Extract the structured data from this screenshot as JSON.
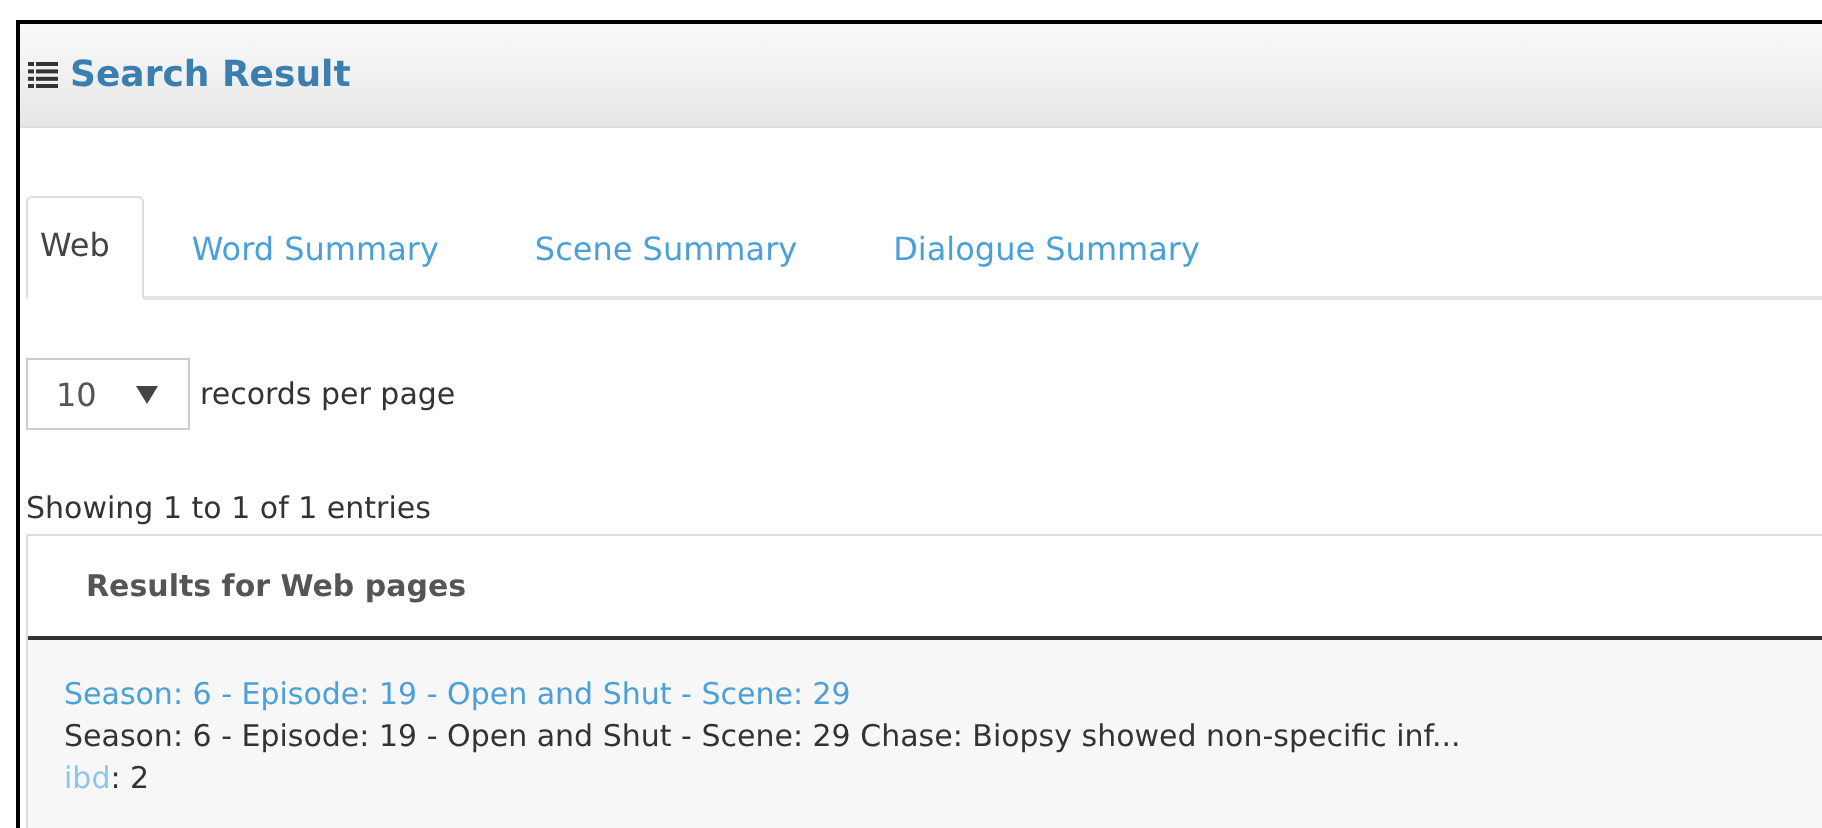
{
  "panel": {
    "title": "Search Result"
  },
  "tabs": [
    {
      "label": "Web",
      "selected": true
    },
    {
      "label": "Word Summary",
      "selected": false
    },
    {
      "label": "Scene Summary",
      "selected": false
    },
    {
      "label": "Dialogue Summary",
      "selected": false
    }
  ],
  "length": {
    "value": "10",
    "suffix": "records per page"
  },
  "info": "Showing 1 to 1 of 1 entries",
  "results": {
    "heading": "Results for Web pages",
    "rows": [
      {
        "title": "Season: 6 - Episode: 19 - Open and Shut - Scene: 29",
        "snippet": "Season: 6 - Episode: 19 - Open and Shut - Scene: 29 Chase: Biopsy showed non-specific inf...",
        "term": "ibd",
        "count": ": 2"
      }
    ]
  }
}
